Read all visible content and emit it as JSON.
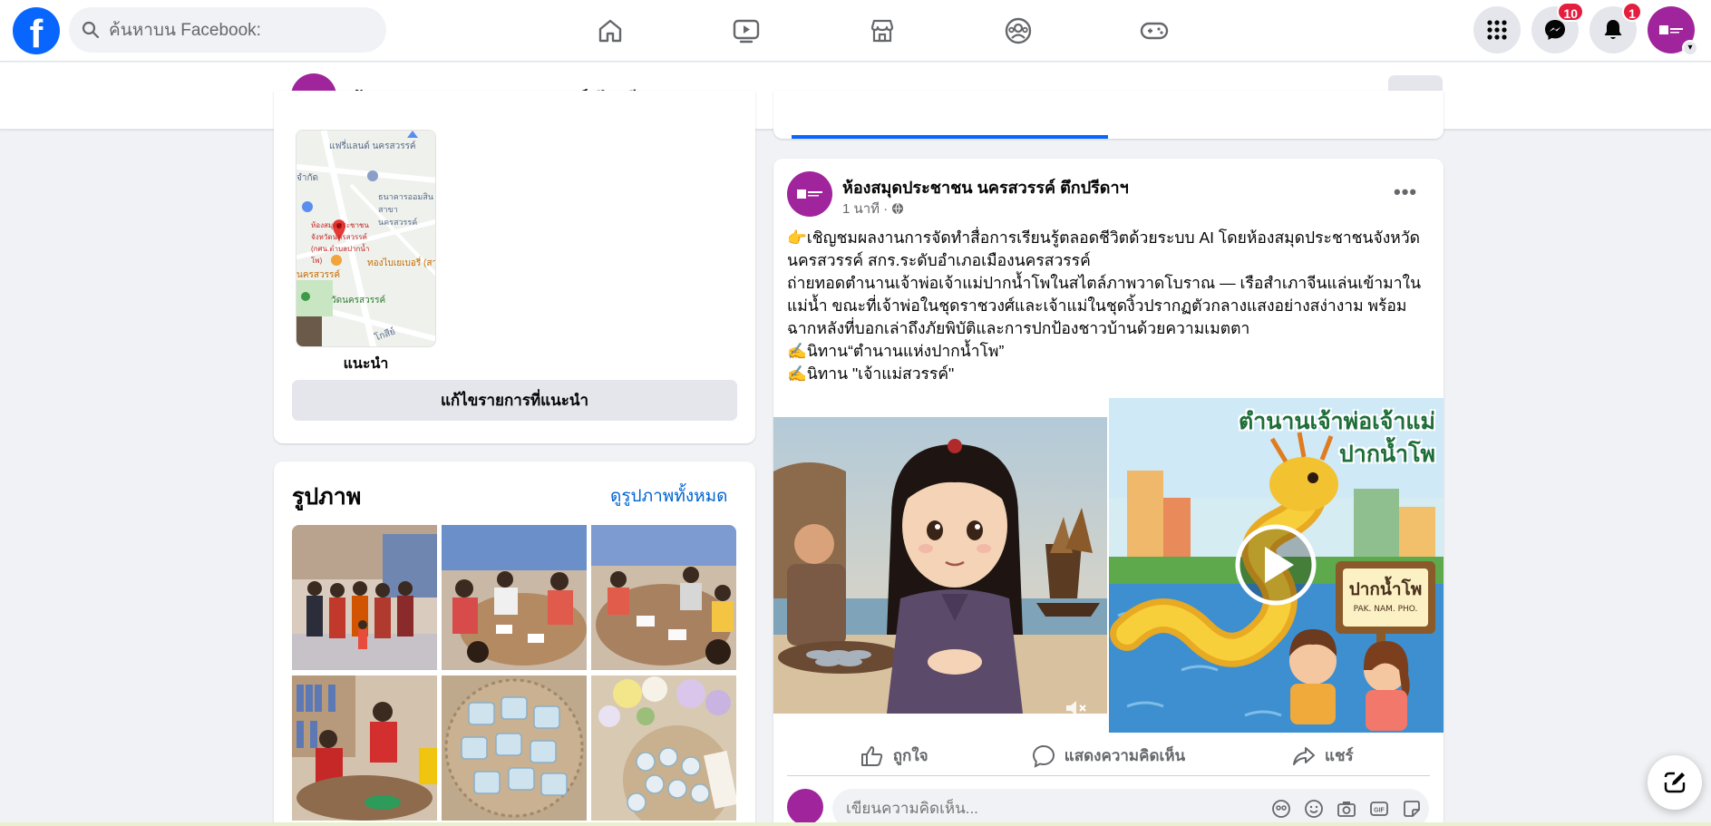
{
  "topbar": {
    "search_placeholder": "ค้นหาบน Facebook:",
    "messenger_badge": "10",
    "notifications_badge": "1"
  },
  "page": {
    "name": "ห้องสมุดประชาชน นครสวรรค์ ตึกปรีดาฯ",
    "more_label": "···"
  },
  "recommendations": {
    "map_labels": [
      "แฟรี่แลนด์ นครสวรรค์",
      "ธนาคารออมสิน สาขานครสวรรค์",
      "ห้องสมุดประชาชนจังหวัดนครสวรรค์ (กศน.ตำบลปากน้ำโพ)",
      "ทองไบเยเบอรี่ (สา",
      "วัดนครสวรรค์",
      "จำกัด",
      "นครสวรรค์",
      "โกสีย์"
    ],
    "label": "แนะนำ",
    "edit_button": "แก้ไขรายการที่แนะนำ"
  },
  "photos": {
    "title": "รูปภาพ",
    "see_all": "ดูรูปภาพทั้งหมด"
  },
  "post": {
    "author": "ห้องสมุดประชาชน นครสวรรค์ ตึกปรีดาฯ",
    "time": "1 นาที",
    "more_label": "•••",
    "lines": [
      "👉เชิญชมผลงานการจัดทำสื่อการเรียนรู้ตลอดชีวิตด้วยระบบ AI โดยห้องสมุดประชาชนจังหวัดนครสวรรค์ สกร.ระดับอำเภอเมืองนครสวรรค์",
      "ถ่ายทอดตำนานเจ้าพ่อเจ้าแม่ปากน้ำโพในสไตล์ภาพวาดโบราณ — เรือสำเภาจีนแล่นเข้ามาในแม่น้ำ ขณะที่เจ้าพ่อในชุดราชวงศ์และเจ้าแม่ในชุดงิ้วปรากฏตัวกลางแสงอย่างสง่างาม พร้อมฉากหลังที่บอกเล่าถึงภัยพิบัติและการปกป้องชาวบ้านด้วยความเมตตา",
      "✍️นิทาน“ตำนานแห่งปากน้ำโพ”",
      "✍️นิทาน \"เจ้าแม่สวรรค์\""
    ],
    "video_title_line1": "ตำนานเจ้าพ่อเจ้าแม่",
    "video_title_line2": "ปากน้ำโพ",
    "video_sign": "ปากน้ำโพ",
    "video_sign_sub": "PAK. NAM. PHO.",
    "like": "ถูกใจ",
    "comment": "แสดงความคิดเห็น",
    "share": "แชร์",
    "comment_placeholder": "เขียนความคิดเห็น..."
  },
  "colors": {
    "brand": "#0866ff",
    "page_avatar": "#a0249c",
    "badge": "#e41e3f",
    "link": "#0064d1"
  }
}
